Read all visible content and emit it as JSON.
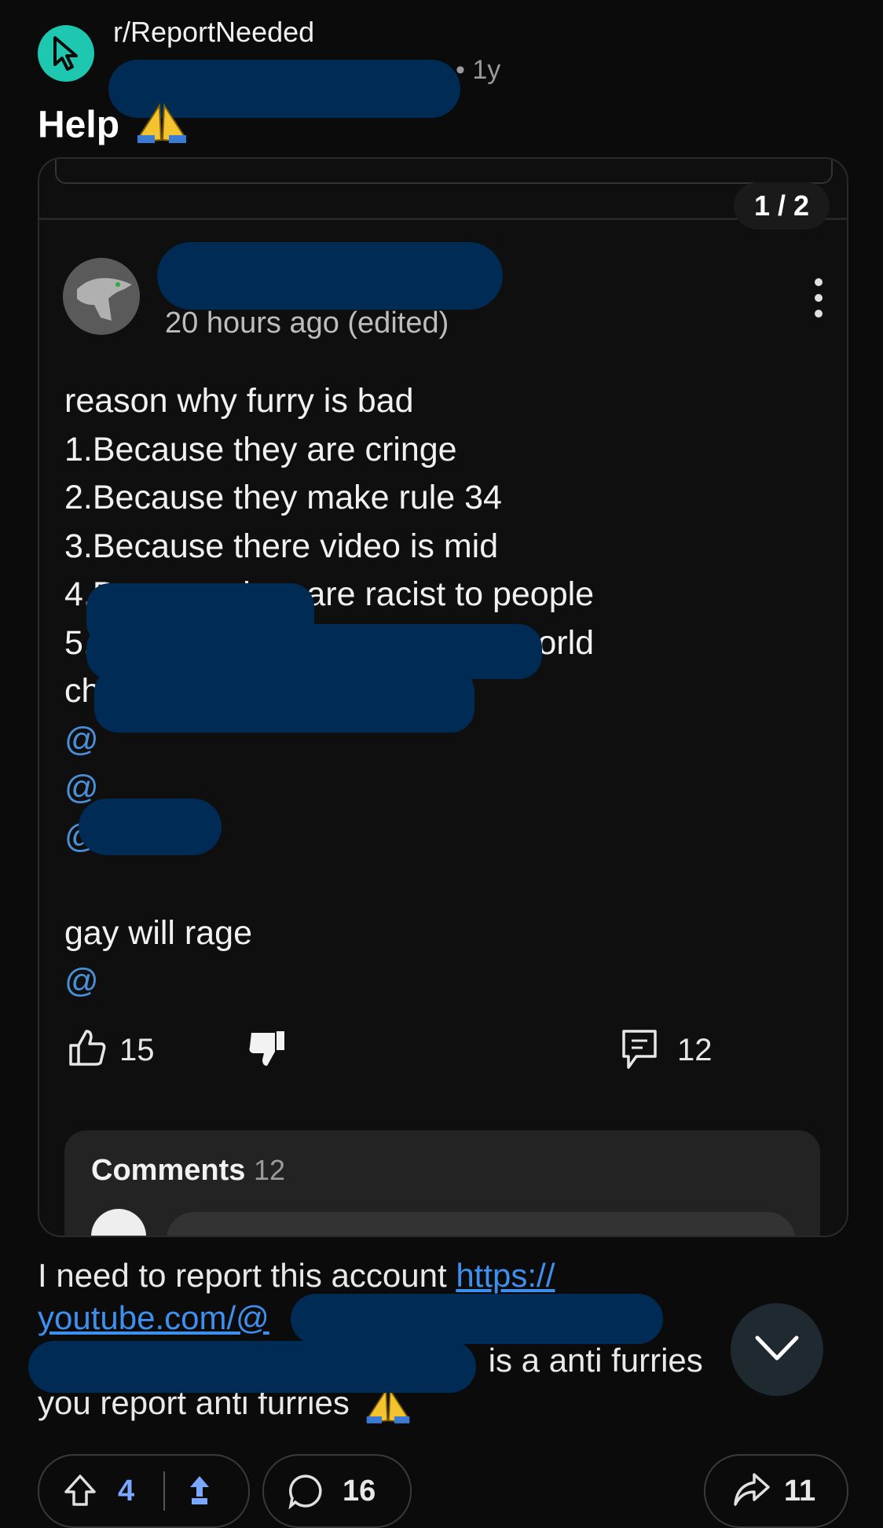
{
  "post": {
    "subreddit": "r/ReportNeeded",
    "age": "• 1y",
    "title": "Help",
    "body": {
      "text_before_link": "I need to report this account ",
      "link_text_1": "https://",
      "link_text_2": "youtube.com/@",
      "text_after_link": " is a anti furries",
      "closing": "you report anti furries"
    }
  },
  "embedded_screenshot": {
    "page_counter": "1 / 2",
    "comment_time": "20 hours ago (edited)",
    "lines": [
      "reason why furry is bad",
      "1.Because they are cringe",
      "2.Because they make rule 34",
      "3.Because there video is mid",
      "4.Because they are racist to people",
      "5.Because should exist in the world",
      "chad will agree"
    ],
    "mention_prefix": "@",
    "gay_line": "gay will rage",
    "likes": "15",
    "replies": "12",
    "comments_label": "Comments",
    "comments_count": "12"
  },
  "action_bar": {
    "upvotes": "4",
    "comments": "16",
    "shares": "11"
  },
  "colors": {
    "accent_subreddit": "#1ec8b0",
    "link": "#3d8ff0",
    "redaction": "#002b55"
  },
  "icons": [
    "cursor-icon",
    "praying-hands-icon",
    "kebab-menu-icon",
    "thumbs-up-icon",
    "thumbs-down-icon",
    "reply-icon",
    "chevron-down-icon",
    "upvote-icon",
    "award-icon",
    "comment-icon",
    "share-icon"
  ]
}
